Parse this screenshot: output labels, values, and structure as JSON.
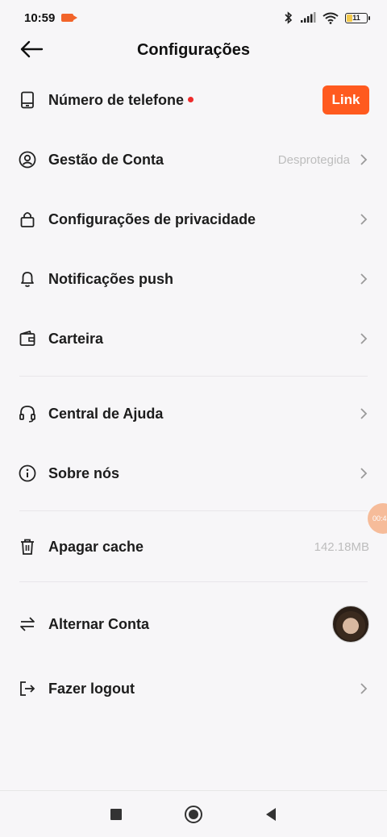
{
  "status_bar": {
    "time": "10:59",
    "battery": "11"
  },
  "header": {
    "title": "Configurações"
  },
  "rows": [
    {
      "label": "Número de telefone",
      "icon": "phone-icon",
      "right_button": "Link"
    },
    {
      "label": "Gestão de Conta",
      "icon": "account-icon",
      "right_text": "Desprotegida"
    },
    {
      "label": "Configurações de privacidade",
      "icon": "lock-icon"
    },
    {
      "label": "Notificações push",
      "icon": "bell-icon"
    },
    {
      "label": "Carteira",
      "icon": "wallet-icon"
    },
    {
      "label": "Central de Ajuda",
      "icon": "headset-icon"
    },
    {
      "label": "Sobre nós",
      "icon": "info-icon"
    },
    {
      "label": "Apagar cache",
      "icon": "trash-icon",
      "right_text": "142.18MB"
    },
    {
      "label": "Alternar Conta",
      "icon": "switch-icon"
    },
    {
      "label": "Fazer logout",
      "icon": "logout-icon"
    }
  ],
  "floating_bubble": {
    "text": "00:4"
  },
  "colors": {
    "accent": "#ff5a1f",
    "dot": "#ee2b2b",
    "muted": "#bdbdbd"
  }
}
